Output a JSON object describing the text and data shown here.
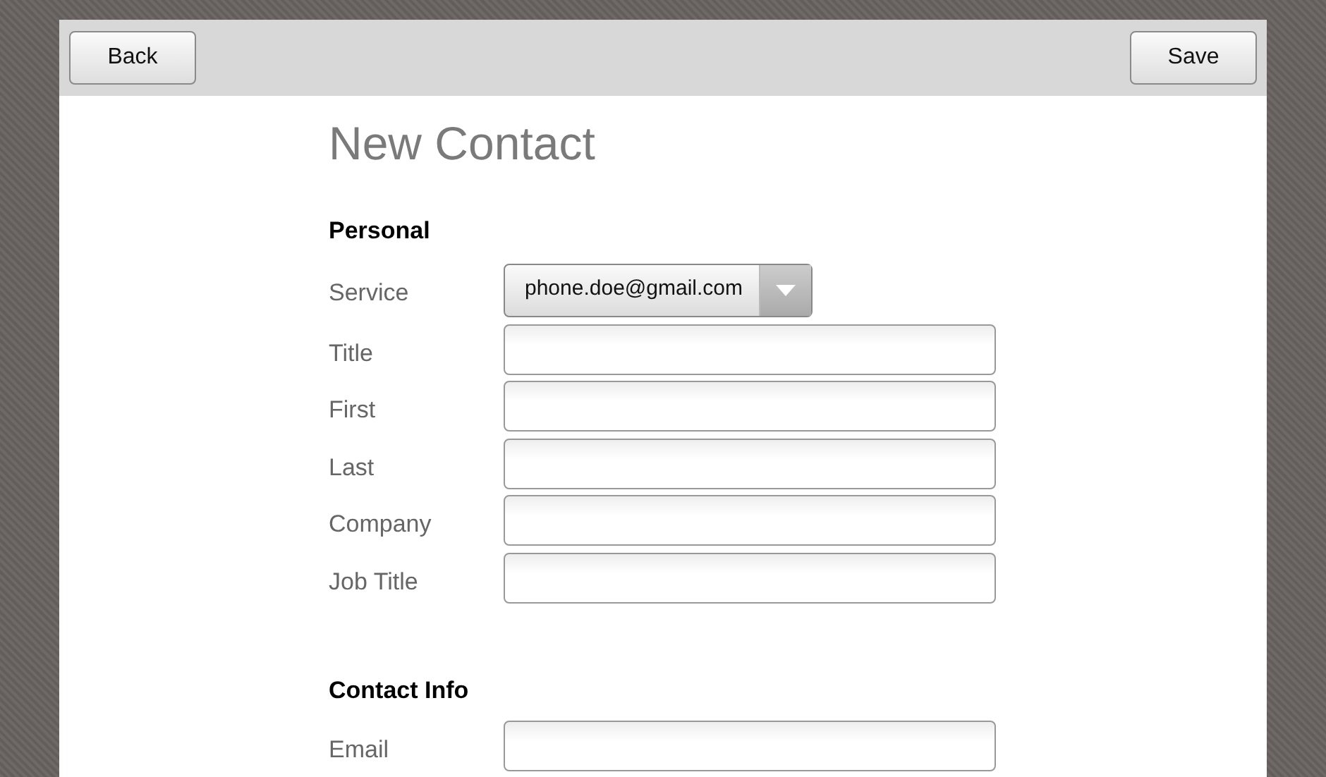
{
  "toolbar": {
    "back_button": "Back",
    "save_button": "Save"
  },
  "title": "New Contact",
  "sections": [
    {
      "heading": "Personal",
      "fields": [
        {
          "kind": "select",
          "label": "Service",
          "value": "phone.doe@gmail.com"
        },
        {
          "kind": "text",
          "label": "Title"
        },
        {
          "kind": "text",
          "label": "First"
        },
        {
          "kind": "text",
          "label": "Last"
        },
        {
          "kind": "text",
          "label": "Company"
        },
        {
          "kind": "text",
          "label": "Job Title"
        }
      ]
    },
    {
      "heading": "Contact Info",
      "fields": [
        {
          "kind": "text",
          "label": "Email"
        }
      ]
    }
  ]
}
